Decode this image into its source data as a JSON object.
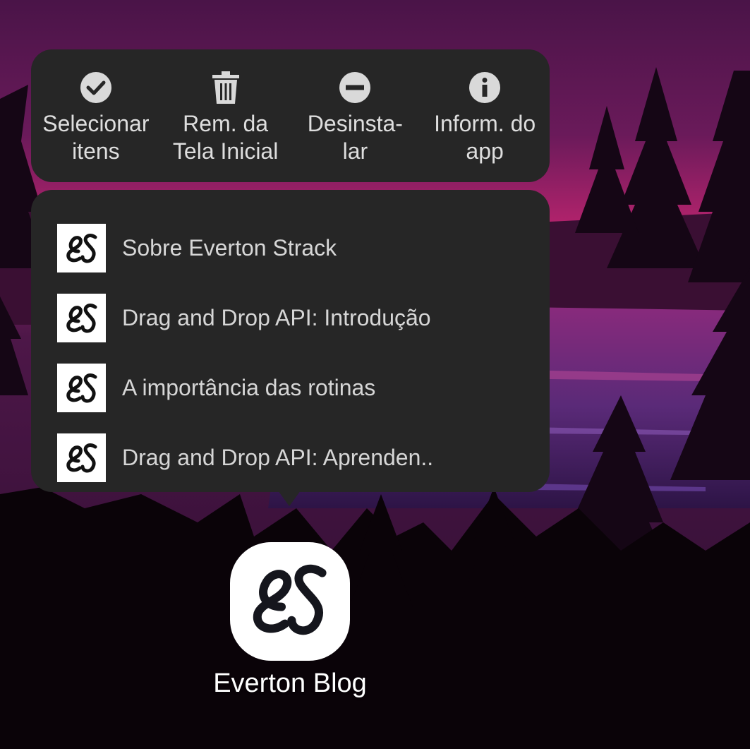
{
  "colors": {
    "panel_bg": "#262626",
    "panel_text": "#dedede",
    "sky_top": "#4a1448",
    "sky_glow": "#c2246e",
    "forest": "#0a0308"
  },
  "actions": [
    {
      "label": "Selecionar\nitens",
      "icon": "check-circle-icon"
    },
    {
      "label": "Rem. da\nTela Inicial",
      "icon": "trash-icon"
    },
    {
      "label": "Desinsta-\nlar",
      "icon": "minus-circle-icon"
    },
    {
      "label": "Inform. do\napp",
      "icon": "info-circle-icon"
    }
  ],
  "shortcuts": [
    {
      "label": "Sobre Everton Strack",
      "icon": "es-logo-icon"
    },
    {
      "label": "Drag and Drop API: Introdução",
      "icon": "es-logo-icon"
    },
    {
      "label": "A importância das rotinas",
      "icon": "es-logo-icon"
    },
    {
      "label": "Drag and Drop API: Aprenden..",
      "icon": "es-logo-icon"
    }
  ],
  "app": {
    "name": "Everton Blog",
    "icon": "es-logo-icon",
    "icon_text": "es"
  }
}
